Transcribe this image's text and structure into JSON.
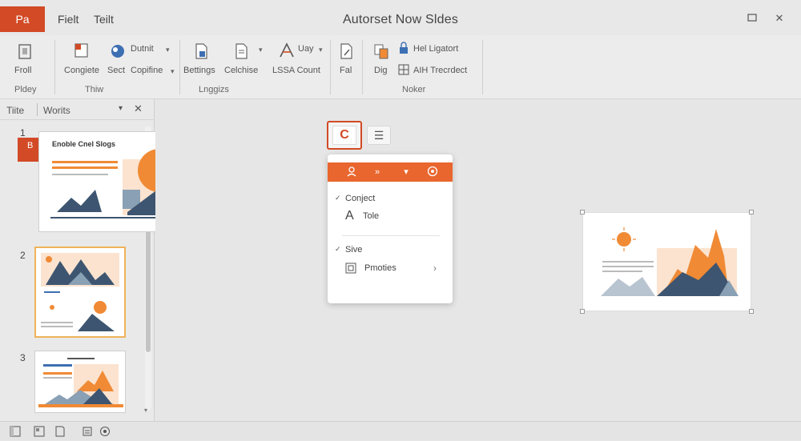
{
  "titlebar": {
    "app_badge": "Pa",
    "menus": [
      "Fielt",
      "Teilt"
    ],
    "doc_title": "Autorset Now Sldes"
  },
  "ribbon": {
    "buttons": {
      "froll": "Froll",
      "congiete": "Congiete",
      "dutnit": "Dutnit",
      "sect": "Sect",
      "copifine": "Copifine",
      "bettings": "Bettings",
      "celchise": "Celchise",
      "uay": "Uay",
      "lssa_count": "LSSA Count",
      "fal": "Fal",
      "dig": "Dig",
      "hel_ligatort": "Hel Ligatort",
      "aih_trecrdect": "AIH Trecrdect"
    },
    "groups": {
      "pldey": "Pldey",
      "thiw": "Thiw",
      "lnggizs": "Lnggizs",
      "noker": "Noker"
    }
  },
  "left_panel": {
    "tabs": [
      "Tiite",
      "Worits"
    ],
    "slides": [
      {
        "number": "1",
        "title": "Enoble Cnel Slogs"
      },
      {
        "number": "2"
      },
      {
        "number": "3"
      }
    ]
  },
  "copilot": {
    "button_label": "C"
  },
  "popup": {
    "items": [
      {
        "label": "Conject",
        "checked": true
      },
      {
        "label": "Tole",
        "checked": false
      },
      {
        "label": "Sive",
        "checked": true
      },
      {
        "label": "Pmoties",
        "checked": false
      }
    ]
  },
  "colors": {
    "accent": "#d24a26",
    "orange": "#f08a35",
    "slate": "#3d5570",
    "light_slate": "#8aa0b4",
    "peach": "#fbe3cf"
  }
}
